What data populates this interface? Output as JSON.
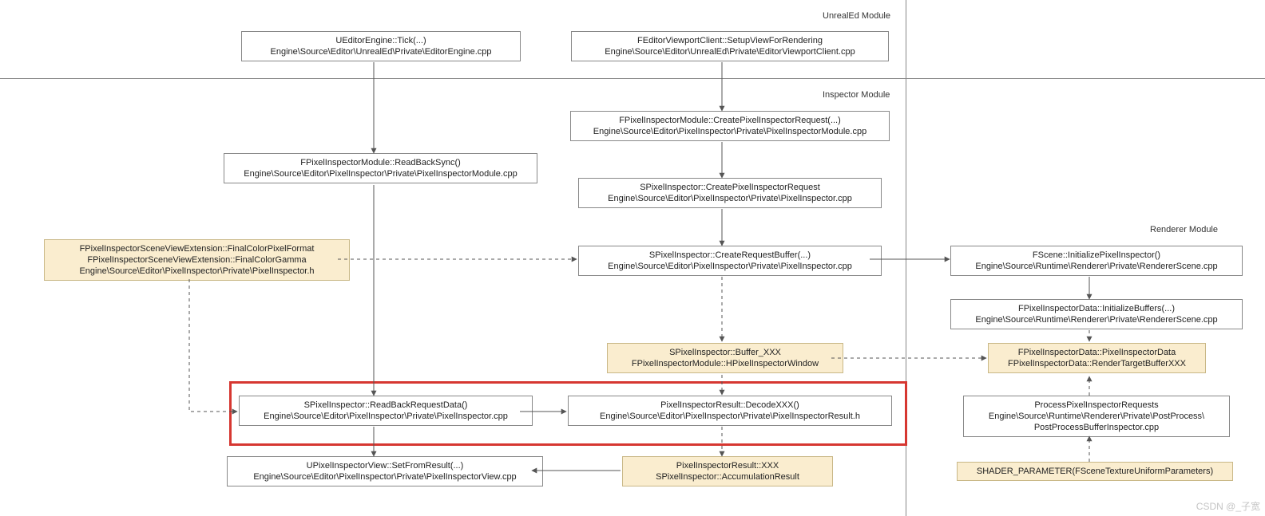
{
  "modules": {
    "unrealed": "UnrealEd Module",
    "inspector": "Inspector Module",
    "renderer": "Renderer Module"
  },
  "nodes": {
    "n1": {
      "l1": "UEditorEngine::Tick(...)",
      "l2": "Engine\\Source\\Editor\\UnrealEd\\Private\\EditorEngine.cpp"
    },
    "n2": {
      "l1": "FEditorViewportClient::SetupViewForRendering",
      "l2": "Engine\\Source\\Editor\\UnrealEd\\Private\\EditorViewportClient.cpp"
    },
    "n3": {
      "l1": "FPixelInspectorModule::CreatePixelInspectorRequest(...)",
      "l2": "Engine\\Source\\Editor\\PixelInspector\\Private\\PixelInspectorModule.cpp"
    },
    "n4": {
      "l1": "FPixelInspectorModule::ReadBackSync()",
      "l2": "Engine\\Source\\Editor\\PixelInspector\\Private\\PixelInspectorModule.cpp"
    },
    "n5": {
      "l1": "SPixelInspector::CreatePixelInspectorRequest",
      "l2": "Engine\\Source\\Editor\\PixelInspector\\Private\\PixelInspector.cpp"
    },
    "n6": {
      "l1": "SPixelInspector::CreateRequestBuffer(...)",
      "l2": "Engine\\Source\\Editor\\PixelInspector\\Private\\PixelInspector.cpp"
    },
    "n7": {
      "l1": "FPixelInspectorSceneViewExtension::FinalColorPixelFormat",
      "l2": "FPixelInspectorSceneViewExtension::FinalColorGamma",
      "l3": "Engine\\Source\\Editor\\PixelInspector\\Private\\PixelInspector.h"
    },
    "n8": {
      "l1": "SPixelInspector::Buffer_XXX",
      "l2": "FPixelInspectorModule::HPixelInspectorWindow"
    },
    "n9": {
      "l1": "SPixelInspector::ReadBackRequestData()",
      "l2": "Engine\\Source\\Editor\\PixelInspector\\Private\\PixelInspector.cpp"
    },
    "n10": {
      "l1": "PixelInspectorResult::DecodeXXX()",
      "l2": "Engine\\Source\\Editor\\PixelInspector\\Private\\PixelInspectorResult.h"
    },
    "n11": {
      "l1": "UPixelInspectorView::SetFromResult(...)",
      "l2": "Engine\\Source\\Editor\\PixelInspector\\Private\\PixelInspectorView.cpp"
    },
    "n12": {
      "l1": "PixelInspectorResult::XXX",
      "l2": "SPixelInspector::AccumulationResult"
    },
    "n13": {
      "l1": "FScene::InitializePixelInspector()",
      "l2": "Engine\\Source\\Runtime\\Renderer\\Private\\RendererScene.cpp"
    },
    "n14": {
      "l1": "FPixelInspectorData::InitializeBuffers(...)",
      "l2": "Engine\\Source\\Runtime\\Renderer\\Private\\RendererScene.cpp"
    },
    "n15": {
      "l1": "FPixelInspectorData::PixelInspectorData",
      "l2": "FPixelInspectorData::RenderTargetBufferXXX"
    },
    "n16": {
      "l1": "ProcessPixelInspectorRequests",
      "l2": "Engine\\Source\\Runtime\\Renderer\\Private\\PostProcess\\",
      "l3": "PostProcessBufferInspector.cpp"
    },
    "n17": {
      "l1": "SHADER_PARAMETER(FSceneTextureUniformParameters)"
    }
  },
  "watermark": "CSDN @_子宽"
}
